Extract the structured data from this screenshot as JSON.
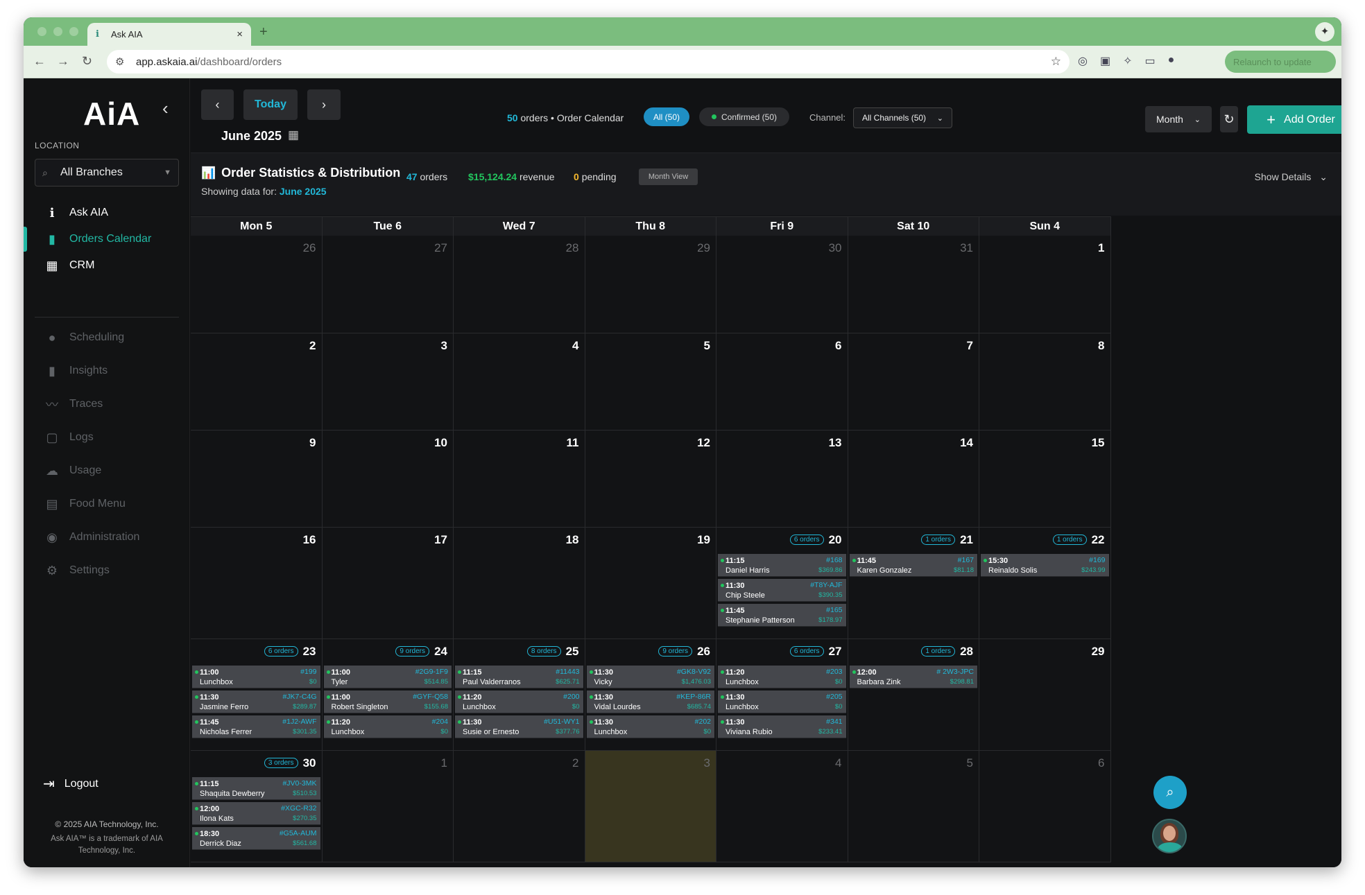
{
  "browser": {
    "tab_title": "Ask AIA",
    "tab_icon": "i",
    "url_domain": "app.askaia.ai",
    "url_path": "/dashboard/orders",
    "relaunch_label": "Relaunch to update"
  },
  "sidebar": {
    "logo": "AiA",
    "location_label": "LOCATION",
    "branch_value": "All Branches",
    "items": [
      {
        "label": "Ask AIA",
        "icon": "info-icon"
      },
      {
        "label": "Orders Calendar",
        "icon": "clipboard-icon"
      },
      {
        "label": "CRM",
        "icon": "dashboard-icon"
      },
      {
        "label": "Scheduling",
        "icon": "person-icon"
      },
      {
        "label": "Insights",
        "icon": "bar-chart-icon"
      },
      {
        "label": "Traces",
        "icon": "trend-icon"
      },
      {
        "label": "Logs",
        "icon": "comment-icon"
      },
      {
        "label": "Usage",
        "icon": "cloud-icon"
      },
      {
        "label": "Food Menu",
        "icon": "book-icon"
      },
      {
        "label": "Administration",
        "icon": "admin-icon"
      },
      {
        "label": "Settings",
        "icon": "gear-icon"
      }
    ],
    "logout_label": "Logout",
    "copyright": "© 2025 AIA Technology, Inc.",
    "trademark": "Ask AIA™ is a trademark of AIA Technology, Inc."
  },
  "header": {
    "today_label": "Today",
    "month_title": "June 2025",
    "orders_count": "50",
    "orders_label": "orders • Order Calendar",
    "filter_all": "All (50)",
    "filter_confirmed": "Confirmed (50)",
    "channel_label": "Channel:",
    "channel_value": "All Channels (50)",
    "view_value": "Month",
    "add_order_label": "Add Order"
  },
  "stats": {
    "title": "Order Statistics & Distribution",
    "showing_prefix": "Showing data for:",
    "showing_value": "June 2025",
    "orders_value": "47",
    "orders_label": "orders",
    "revenue_value": "$15,124.24",
    "revenue_label": "revenue",
    "pending_value": "0",
    "pending_label": "pending",
    "view_badge": "Month View",
    "show_details": "Show Details"
  },
  "calendar": {
    "day_headers": [
      "Mon 5",
      "Tue 6",
      "Wed 7",
      "Thu 8",
      "Fri 9",
      "Sat 10",
      "Sun 4"
    ],
    "weeks": [
      [
        {
          "day": "26",
          "dim": true
        },
        {
          "day": "27",
          "dim": true
        },
        {
          "day": "28",
          "dim": true
        },
        {
          "day": "29",
          "dim": true
        },
        {
          "day": "30",
          "dim": true
        },
        {
          "day": "31",
          "dim": true
        },
        {
          "day": "1"
        }
      ],
      [
        {
          "day": "2"
        },
        {
          "day": "3"
        },
        {
          "day": "4"
        },
        {
          "day": "5"
        },
        {
          "day": "6"
        },
        {
          "day": "7"
        },
        {
          "day": "8"
        }
      ],
      [
        {
          "day": "9"
        },
        {
          "day": "10"
        },
        {
          "day": "11"
        },
        {
          "day": "12"
        },
        {
          "day": "13"
        },
        {
          "day": "14"
        },
        {
          "day": "15"
        }
      ],
      [
        {
          "day": "16"
        },
        {
          "day": "17"
        },
        {
          "day": "18"
        },
        {
          "day": "19"
        },
        {
          "day": "20",
          "count": "6 orders",
          "orders": [
            {
              "time": "11:15",
              "name": "Daniel Harris",
              "id": "#168",
              "price": "$369.86"
            },
            {
              "time": "11:30",
              "name": "Chip Steele",
              "id": "#T8Y-AJF",
              "price": "$390.35"
            },
            {
              "time": "11:45",
              "name": "Stephanie Patterson",
              "id": "#165",
              "price": "$178.97"
            }
          ]
        },
        {
          "day": "21",
          "count": "1 orders",
          "orders": [
            {
              "time": "11:45",
              "name": "Karen Gonzalez",
              "id": "#167",
              "price": "$81.18"
            }
          ]
        },
        {
          "day": "22",
          "count": "1 orders",
          "orders": [
            {
              "time": "15:30",
              "name": "Reinaldo Solis",
              "id": "#169",
              "price": "$243.99"
            }
          ]
        }
      ],
      [
        {
          "day": "23",
          "count": "6 orders",
          "orders": [
            {
              "time": "11:00",
              "name": "Lunchbox",
              "id": "#199",
              "price": "$0"
            },
            {
              "time": "11:30",
              "name": "Jasmine Ferro",
              "id": "#JK7-C4G",
              "price": "$289.87"
            },
            {
              "time": "11:45",
              "name": "Nicholas Ferrer",
              "id": "#1J2-AWF",
              "price": "$301.35"
            }
          ]
        },
        {
          "day": "24",
          "count": "9 orders",
          "orders": [
            {
              "time": "11:00",
              "name": "Tyler",
              "id": "#2G9-1F9",
              "price": "$514.85"
            },
            {
              "time": "11:00",
              "name": "Robert Singleton",
              "id": "#GYF-Q58",
              "price": "$155.68"
            },
            {
              "time": "11:20",
              "name": "Lunchbox",
              "id": "#204",
              "price": "$0"
            }
          ]
        },
        {
          "day": "25",
          "count": "8 orders",
          "orders": [
            {
              "time": "11:15",
              "name": "Paul Valderranos",
              "id": "#11443",
              "price": "$625.71"
            },
            {
              "time": "11:20",
              "name": "Lunchbox",
              "id": "#200",
              "price": "$0"
            },
            {
              "time": "11:30",
              "name": "Susie or Ernesto",
              "id": "#U51-WY1",
              "price": "$377.76"
            }
          ]
        },
        {
          "day": "26",
          "count": "9 orders",
          "orders": [
            {
              "time": "11:30",
              "name": "Vicky",
              "id": "#GK8-V92",
              "price": "$1,476.03"
            },
            {
              "time": "11:30",
              "name": "Vidal Lourdes",
              "id": "#KEP-86R",
              "price": "$685.74"
            },
            {
              "time": "11:30",
              "name": "Lunchbox",
              "id": "#202",
              "price": "$0"
            }
          ]
        },
        {
          "day": "27",
          "count": "6 orders",
          "orders": [
            {
              "time": "11:20",
              "name": "Lunchbox",
              "id": "#203",
              "price": "$0"
            },
            {
              "time": "11:30",
              "name": "Lunchbox",
              "id": "#205",
              "price": "$0"
            },
            {
              "time": "11:30",
              "name": "Viviana Rubio",
              "id": "#341",
              "price": "$233.41"
            }
          ]
        },
        {
          "day": "28",
          "count": "1 orders",
          "orders": [
            {
              "time": "12:00",
              "name": "Barbara Zink",
              "id": "# 2W3-JPC",
              "price": "$298.81"
            }
          ]
        },
        {
          "day": "29"
        }
      ],
      [
        {
          "day": "30",
          "count": "3 orders",
          "orders": [
            {
              "time": "11:15",
              "name": "Shaquita Dewberry",
              "id": "#JV0-3MK",
              "price": "$510.53"
            },
            {
              "time": "12:00",
              "name": "Ilona Kats",
              "id": "#XGC-R32",
              "price": "$270.35"
            },
            {
              "time": "18:30",
              "name": "Derrick Diaz",
              "id": "#G5A-AUM",
              "price": "$561.68"
            }
          ]
        },
        {
          "day": "1",
          "dim": true
        },
        {
          "day": "2",
          "dim": true
        },
        {
          "day": "3",
          "dim": true,
          "highlight": true
        },
        {
          "day": "4",
          "dim": true
        },
        {
          "day": "5",
          "dim": true
        },
        {
          "day": "6",
          "dim": true
        }
      ]
    ]
  },
  "colors": {
    "accent": "#22b8d8",
    "brand": "#1ea592",
    "confirmed": "#22c55e",
    "browser_chrome": "#7bbd7e"
  }
}
